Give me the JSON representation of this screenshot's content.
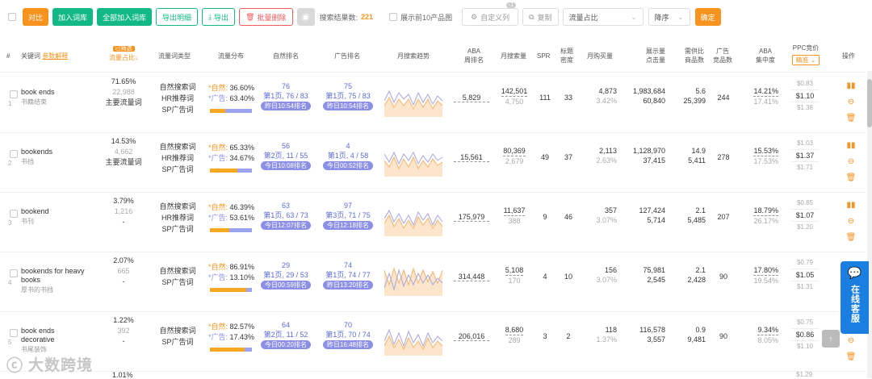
{
  "toolbar": {
    "compare": "对比",
    "add_lib": "加入词库",
    "add_all_lib": "全部加入词库",
    "export_detail": "导出明细",
    "export": "导出",
    "batch_delete": "批量删除",
    "result_label": "搜索结果数:",
    "result_count": "221",
    "top10_label": "展示前10产品图",
    "custom_badge": "-1",
    "custom_label": "自定义列",
    "copy_label": "复制",
    "sort_field": "流量占比",
    "sort_order": "降序",
    "confirm": "确定"
  },
  "headers": {
    "hash": "#",
    "keyword": "关键词",
    "keyword_link": "参数解释",
    "traffic_tag": "已筛选",
    "traffic_share": "流量占比↓",
    "traffic_type": "流量词类型",
    "traffic_dist": "流量分布",
    "natural_rank": "自然排名",
    "ad_rank": "广告排名",
    "monthly_trend": "月搜索趋势",
    "aba": "ABA\n周排名",
    "monthly_search": "月搜索量",
    "spr": "SPR",
    "title_density": "标题\n密度",
    "monthly_buy": "月购买量",
    "display_click": "展示量\n点击量",
    "supply_ratio": "需供比\n商品数",
    "ad_count": "广告\n竞品数",
    "aba_conc": "ABA\n集中度",
    "ppc": "PPC竞价",
    "ppc_select": "精准",
    "ops": "操作"
  },
  "rows": [
    {
      "idx": "1",
      "kw": "book ends",
      "cn": "书籍结束",
      "share": "71.65%",
      "share_num": "22,988",
      "share_tag": "主要流量词",
      "share_dash": "",
      "types": [
        "自然搜索词",
        "HR推荐词",
        "SP广告词"
      ],
      "nat": "36.60%",
      "ad": "63.40%",
      "nat_pct": 36.6,
      "nr_top": "76",
      "nr_mid": "第1页, 76 / 83",
      "nr_badge": "昨日10:54排名",
      "ar_top": "75",
      "ar_mid": "第1页, 75 / 83",
      "ar_badge": "昨日10:54排名",
      "aba": "5,829",
      "ms1": "142,501",
      "ms2": "4,750",
      "spr": "111",
      "td": "33",
      "mb1": "4,873",
      "mb2": "3.42%",
      "dc1": "1,983,684",
      "dc2": "60,840",
      "sr1": "5.6",
      "sr2": "25,399",
      "adc": "244",
      "ac1": "14.21%",
      "ac2": "17.41%",
      "pp1": "$0.83",
      "pp2": "$1.10",
      "pp3": "$1.38"
    },
    {
      "idx": "2",
      "kw": "bookends",
      "cn": "书挡",
      "share": "14.53%",
      "share_num": "4,662",
      "share_tag": "主要流量词",
      "share_dash": "",
      "types": [
        "自然搜索词",
        "HR推荐词",
        "SP广告词"
      ],
      "nat": "65.33%",
      "ad": "34.67%",
      "nat_pct": 65.33,
      "nr_top": "56",
      "nr_mid": "第2页, 11 / 55",
      "nr_badge": "今日10:08排名",
      "ar_top": "4",
      "ar_mid": "第1页, 4 / 58",
      "ar_badge": "今日00:52排名",
      "aba": "15,561",
      "ms1": "80,369",
      "ms2": "2,679",
      "spr": "49",
      "td": "37",
      "mb1": "2,113",
      "mb2": "2.63%",
      "dc1": "1,128,970",
      "dc2": "37,415",
      "sr1": "14.9",
      "sr2": "5,411",
      "adc": "278",
      "ac1": "15.53%",
      "ac2": "17.53%",
      "pp1": "$1.03",
      "pp2": "$1.37",
      "pp3": "$1.71"
    },
    {
      "idx": "3",
      "kw": "bookend",
      "cn": "书刊",
      "share": "3.79%",
      "share_num": "1,216",
      "share_tag": "",
      "share_dash": "-",
      "types": [
        "自然搜索词",
        "HR推荐词",
        "SP广告词"
      ],
      "nat": "46.39%",
      "ad": "53.61%",
      "nat_pct": 46.39,
      "nr_top": "63",
      "nr_mid": "第1页, 63 / 73",
      "nr_badge": "今日12:07排名",
      "ar_top": "97",
      "ar_mid": "第3页, 71 / 75",
      "ar_badge": "今日12:18排名",
      "aba": "175,979",
      "ms1": "11,637",
      "ms2": "388",
      "spr": "9",
      "td": "46",
      "mb1": "357",
      "mb2": "3.07%",
      "dc1": "127,424",
      "dc2": "5,714",
      "sr1": "2.1",
      "sr2": "5,485",
      "adc": "207",
      "ac1": "18.79%",
      "ac2": "26.17%",
      "pp1": "$0.85",
      "pp2": "$1.07",
      "pp3": "$1.20"
    },
    {
      "idx": "4",
      "kw": "bookends for heavy books",
      "cn": "厚书的书挡",
      "share": "2.07%",
      "share_num": "665",
      "share_tag": "",
      "share_dash": "-",
      "types": [
        "自然搜索词",
        "SP广告词"
      ],
      "nat": "86.91%",
      "ad": "13.10%",
      "nat_pct": 86.91,
      "nr_top": "29",
      "nr_mid": "第1页, 29 / 53",
      "nr_badge": "今日00:59排名",
      "ar_top": "74",
      "ar_mid": "第1页, 74 / 77",
      "ar_badge": "昨日13:20排名",
      "aba": "314,448",
      "ms1": "5,108",
      "ms2": "170",
      "spr": "4",
      "td": "10",
      "mb1": "156",
      "mb2": "3.07%",
      "dc1": "75,981",
      "dc2": "2,545",
      "sr1": "2.1",
      "sr2": "2,428",
      "adc": "90",
      "ac1": "17.80%",
      "ac2": "19.54%",
      "pp1": "$0.79",
      "pp2": "$1.05",
      "pp3": "$1.31"
    },
    {
      "idx": "5",
      "kw": "book ends decorative",
      "cn": "书尾装饰",
      "share": "1.22%",
      "share_num": "392",
      "share_tag": "",
      "share_dash": "-",
      "types": [
        "自然搜索词",
        "SP广告词"
      ],
      "nat": "82.57%",
      "ad": "17.43%",
      "nat_pct": 82.57,
      "nr_top": "64",
      "nr_mid": "第2页, 11 / 52",
      "nr_badge": "今日00:20排名",
      "ar_top": "70",
      "ar_mid": "第1页, 70 / 74",
      "ar_badge": "昨日16:48排名",
      "aba": "206,016",
      "ms1": "8,680",
      "ms2": "289",
      "spr": "3",
      "td": "2",
      "mb1": "118",
      "mb2": "1.37%",
      "dc1": "116,578",
      "dc2": "3,557",
      "sr1": "0.9",
      "sr2": "9,481",
      "adc": "90",
      "ac1": "9.34%",
      "ac2": "8.05%",
      "pp1": "$0.75",
      "pp2": "$0.86",
      "pp3": "$1.10"
    }
  ],
  "partial_row": {
    "share": "1.01%",
    "pp1": "$1.29"
  },
  "labels": {
    "nat_prefix": "*自然:",
    "ad_prefix": "*广告:"
  },
  "float": {
    "chat_label": "在线客服",
    "top_arrow": "↑"
  },
  "watermark": "大数跨境"
}
